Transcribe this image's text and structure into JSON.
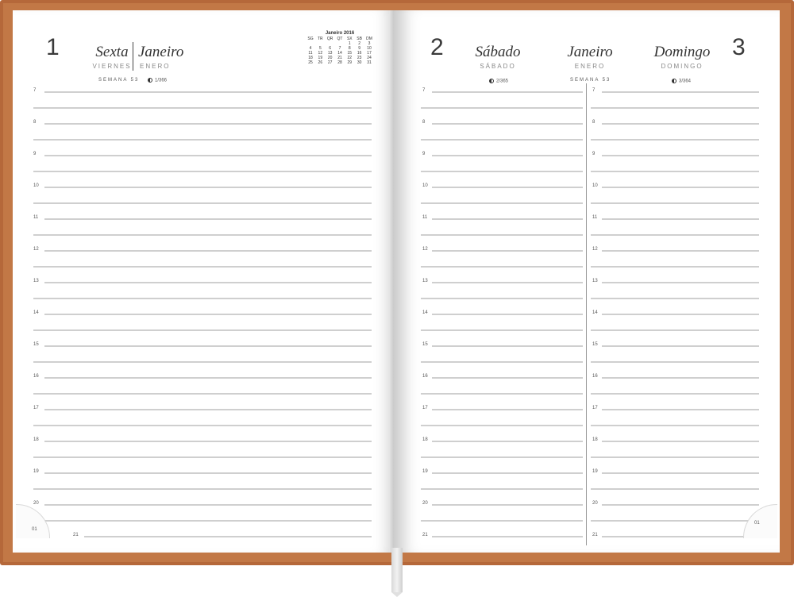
{
  "left_page": {
    "day_number": "1",
    "day_name_pt": "Sexta",
    "day_name_es": "VIERNES",
    "month_pt": "Janeiro",
    "month_es": "ENERO",
    "week": "SEMANA 53",
    "moon_text": "1/366",
    "mini_calendar": {
      "title": "Janeiro 2016",
      "header": [
        "SG",
        "TR",
        "QR",
        "QT",
        "SX",
        "SB",
        "DM"
      ],
      "rows": [
        [
          "",
          "",
          "",
          "",
          "1",
          "2",
          "3"
        ],
        [
          "4",
          "5",
          "6",
          "7",
          "8",
          "9",
          "10"
        ],
        [
          "11",
          "12",
          "13",
          "14",
          "15",
          "16",
          "17"
        ],
        [
          "18",
          "19",
          "20",
          "21",
          "22",
          "23",
          "24"
        ],
        [
          "25",
          "26",
          "27",
          "28",
          "29",
          "30",
          "31"
        ]
      ]
    },
    "hours": [
      "7",
      "8",
      "9",
      "10",
      "11",
      "12",
      "13",
      "14",
      "15",
      "16",
      "17",
      "18",
      "19",
      "20",
      "21"
    ],
    "corner_label": "01"
  },
  "right_page": {
    "col1": {
      "day_number": "2",
      "day_name_pt": "Sábado",
      "day_name_es": "SÁBADO",
      "moon_text": "2/365"
    },
    "month_pt": "Janeiro",
    "month_es": "ENERO",
    "week": "SEMANA 53",
    "col2": {
      "day_number": "3",
      "day_name_pt": "Domingo",
      "day_name_es": "DOMINGO",
      "moon_text": "3/364"
    },
    "hours": [
      "7",
      "8",
      "9",
      "10",
      "11",
      "12",
      "13",
      "14",
      "15",
      "16",
      "17",
      "18",
      "19",
      "20",
      "21"
    ],
    "corner_label": "01"
  }
}
